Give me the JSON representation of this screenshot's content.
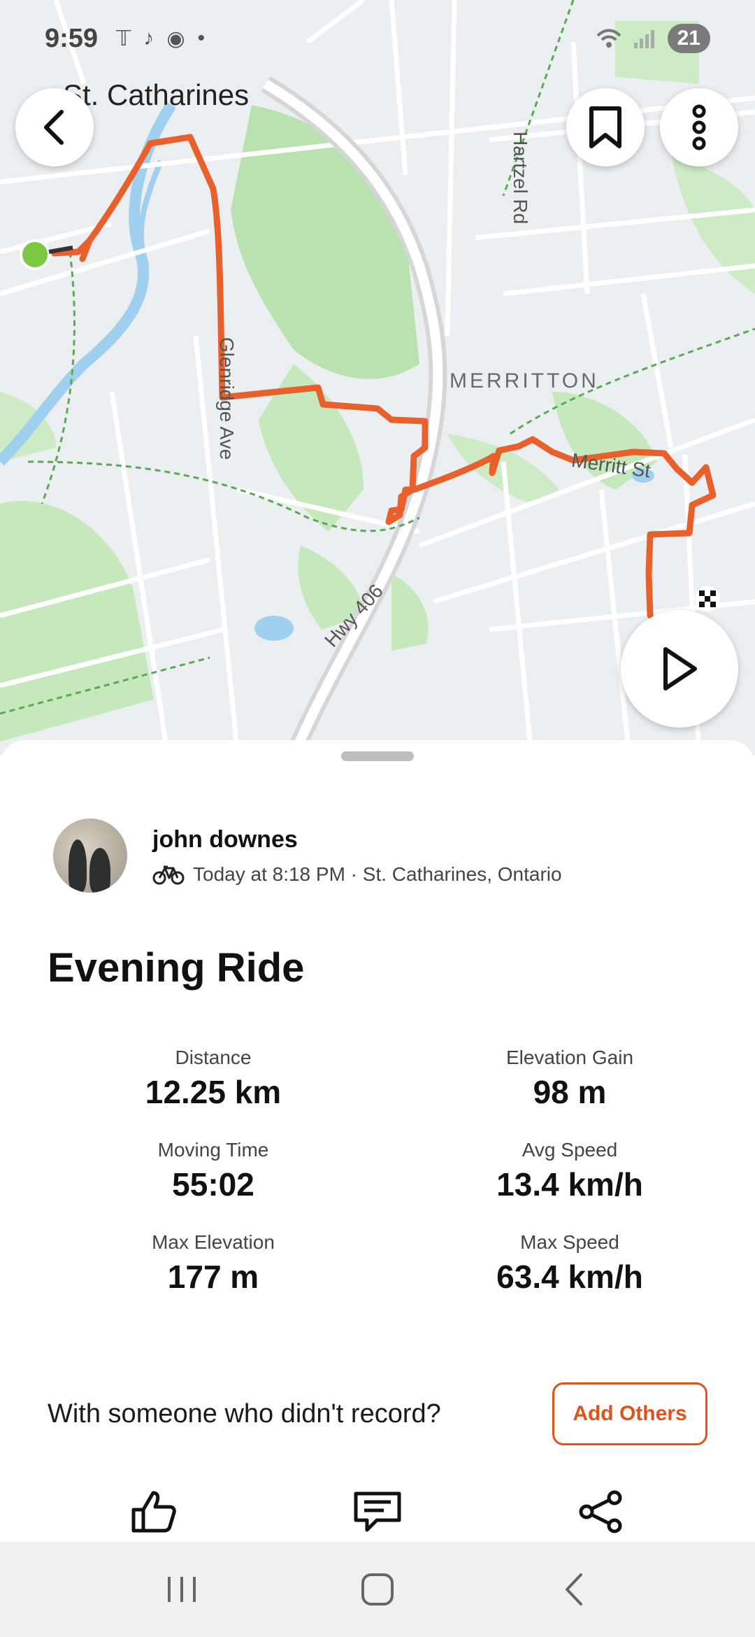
{
  "status_bar": {
    "time": "9:59",
    "battery": "21"
  },
  "map": {
    "city": "St. Catharines",
    "district": "MERRITTON",
    "roads": {
      "glenridge": "Glenridge Ave",
      "hartzel": "Hartzel Rd",
      "hwy": "Hwy 406",
      "merritt": "Merritt St"
    }
  },
  "athlete": {
    "name": "john downes",
    "meta": "Today at 8:18 PM · St. Catharines, Ontario"
  },
  "activity": {
    "title": "Evening Ride"
  },
  "stats": [
    {
      "label": "Distance",
      "value": "12.25 km"
    },
    {
      "label": "Elevation Gain",
      "value": "98 m"
    },
    {
      "label": "Moving Time",
      "value": "55:02"
    },
    {
      "label": "Avg Speed",
      "value": "13.4 km/h"
    },
    {
      "label": "Max Elevation",
      "value": "177 m"
    },
    {
      "label": "Max Speed",
      "value": "63.4 km/h"
    }
  ],
  "with_others": {
    "text": "With someone who didn't record?",
    "button": "Add Others"
  },
  "colors": {
    "accent": "#e0531c",
    "route": "#e8602c",
    "start": "#7cc843"
  }
}
